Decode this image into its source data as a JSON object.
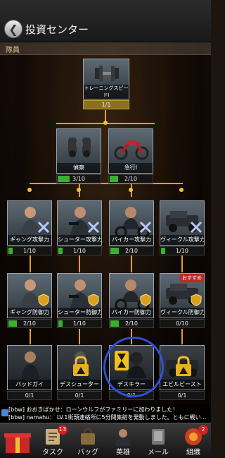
{
  "header": {
    "title": "投資センター",
    "back_icon": "back-arrow-icon"
  },
  "subheader": {
    "label": "隊員"
  },
  "colors": {
    "accent": "#e0a020",
    "progress": "#3ab030",
    "highlight": "#2f4fd8",
    "recommend": "#c02820"
  },
  "nodes": {
    "training": {
      "name": "トレーニングスピードI",
      "progress": "1/1",
      "fill": 1.0
    },
    "scout": {
      "name": "偵察",
      "progress": "3/10",
      "fill": 0.3
    },
    "rush": {
      "name": "急行I",
      "progress": "2/10",
      "fill": 0.2
    },
    "gang_atk": {
      "name": "ギャング攻撃力",
      "progress": "1/10",
      "fill": 0.1
    },
    "shooter_atk": {
      "name": "シューター攻撃力",
      "progress": "1/10",
      "fill": 0.1
    },
    "biker_atk": {
      "name": "バイカー攻撃力",
      "progress": "2/10",
      "fill": 0.2
    },
    "vehicle_atk": {
      "name": "ヴィークル攻撃力",
      "progress": "1/10",
      "fill": 0.1
    },
    "gang_def": {
      "name": "ギャング防御力",
      "progress": "2/10",
      "fill": 0.2
    },
    "shooter_def": {
      "name": "シューター防御力",
      "progress": "1/10",
      "fill": 0.1
    },
    "biker_def": {
      "name": "バイカー防御力",
      "progress": "2/10",
      "fill": 0.2
    },
    "vehicle_def": {
      "name": "ヴィークル防御力",
      "progress": "0/10",
      "fill": 0.0,
      "badge": "おすすめ"
    },
    "badguy": {
      "name": "バッドガイ",
      "progress": "0/1",
      "fill": 0.0
    },
    "deathshooter": {
      "name": "デスシューター",
      "progress": "0/1",
      "fill": 0.0
    },
    "deathkiller": {
      "name": "デスキラー",
      "progress": "0/1",
      "fill": 0.0
    },
    "evilbeast": {
      "name": "エビルビースト",
      "progress": "0/1",
      "fill": 0.0
    }
  },
  "chat": {
    "line1": "[bbw] おおきばかせ：ローンウルフがファミリーに加わりました！",
    "line2": "[bbw] namahu： LV.1街頭連絡所に5分間集結を発動しました。ともに戦い..."
  },
  "nav": {
    "shop": {
      "label": "",
      "badge": ""
    },
    "task": {
      "label": "タスク",
      "badge": "13"
    },
    "bag": {
      "label": "バッグ"
    },
    "hero": {
      "label": "英雄"
    },
    "mail": {
      "label": "メール"
    },
    "family": {
      "label": "組織",
      "badge": "2"
    }
  }
}
